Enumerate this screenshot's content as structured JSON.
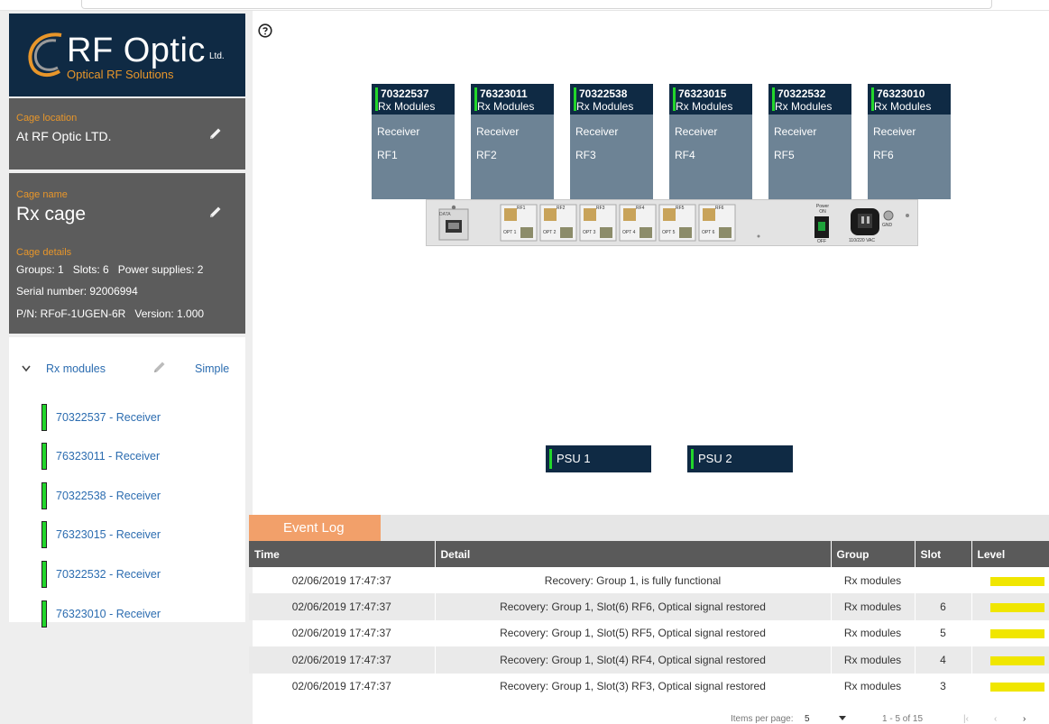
{
  "logo": {
    "brand": "RF Optic",
    "suffix": "Ltd.",
    "tagline": "Optical RF Solutions"
  },
  "cage_location": {
    "label": "Cage location",
    "value": "At RF Optic LTD."
  },
  "cage_name": {
    "label": "Cage name",
    "value": "Rx cage"
  },
  "cage_details": {
    "label": "Cage details",
    "line1": "Groups: 1   Slots: 6   Power supplies: 2",
    "line2": "Serial number: 92006994",
    "line3": "P/N: RFoF-1UGEN-6R   Version: 1.000"
  },
  "modules_group": {
    "label": "Rx modules",
    "mode": "Simple"
  },
  "modules": [
    {
      "label": "70322537 - Receiver"
    },
    {
      "label": "76323011 - Receiver"
    },
    {
      "label": "70322538 - Receiver"
    },
    {
      "label": "76323015 - Receiver"
    },
    {
      "label": "70322532 - Receiver"
    },
    {
      "label": "76323010 - Receiver"
    }
  ],
  "cards": [
    {
      "serial": "70322537",
      "kind": "Rx Modules",
      "type": "Receiver",
      "rf": "RF1"
    },
    {
      "serial": "76323011",
      "kind": "Rx Modules",
      "type": "Receiver",
      "rf": "RF2"
    },
    {
      "serial": "70322538",
      "kind": "Rx Modules",
      "type": "Receiver",
      "rf": "RF3"
    },
    {
      "serial": "76323015",
      "kind": "Rx Modules",
      "type": "Receiver",
      "rf": "RF4"
    },
    {
      "serial": "70322532",
      "kind": "Rx Modules",
      "type": "Receiver",
      "rf": "RF5"
    },
    {
      "serial": "76323010",
      "kind": "Rx Modules",
      "type": "Receiver",
      "rf": "RF6"
    }
  ],
  "chassis": {
    "data_label": "DATA",
    "power_on": "Power ON",
    "power_off": "OFF",
    "mains": "110/220 VAC",
    "gnd": "GND",
    "rf_ports": [
      "RF1",
      "RF2",
      "RF3",
      "RF4",
      "RF5",
      "RF6"
    ],
    "opt_ports": [
      "OPT 1",
      "OPT 2",
      "OPT 3",
      "OPT 4",
      "OPT 5",
      "OPT 6"
    ]
  },
  "psus": [
    {
      "label": "PSU 1"
    },
    {
      "label": "PSU 2"
    }
  ],
  "event_log": {
    "tab": "Event Log",
    "columns": {
      "time": "Time",
      "detail": "Detail",
      "group": "Group",
      "slot": "Slot",
      "level": "Level"
    },
    "rows": [
      {
        "time": "02/06/2019 17:47:37",
        "detail": "Recovery: Group 1, is fully functional",
        "group": "Rx modules",
        "slot": ""
      },
      {
        "time": "02/06/2019 17:47:37",
        "detail": "Recovery: Group 1, Slot(6) RF6, Optical signal restored",
        "group": "Rx modules",
        "slot": "6"
      },
      {
        "time": "02/06/2019 17:47:37",
        "detail": "Recovery: Group 1, Slot(5) RF5, Optical signal restored",
        "group": "Rx modules",
        "slot": "5"
      },
      {
        "time": "02/06/2019 17:47:37",
        "detail": "Recovery: Group 1, Slot(4) RF4, Optical signal restored",
        "group": "Rx modules",
        "slot": "4"
      },
      {
        "time": "02/06/2019 17:47:37",
        "detail": "Recovery: Group 1, Slot(3) RF3, Optical signal restored",
        "group": "Rx modules",
        "slot": "3"
      }
    ],
    "level_color": "#f0e600"
  },
  "pager": {
    "items_label": "Items per page:",
    "items_value": "5",
    "range": "1 - 5 of 15"
  },
  "colors": {
    "navy": "#0f2a44",
    "accent_orange": "#e8962a",
    "status_green": "#22d62b",
    "card_gray": "#6d8395"
  }
}
